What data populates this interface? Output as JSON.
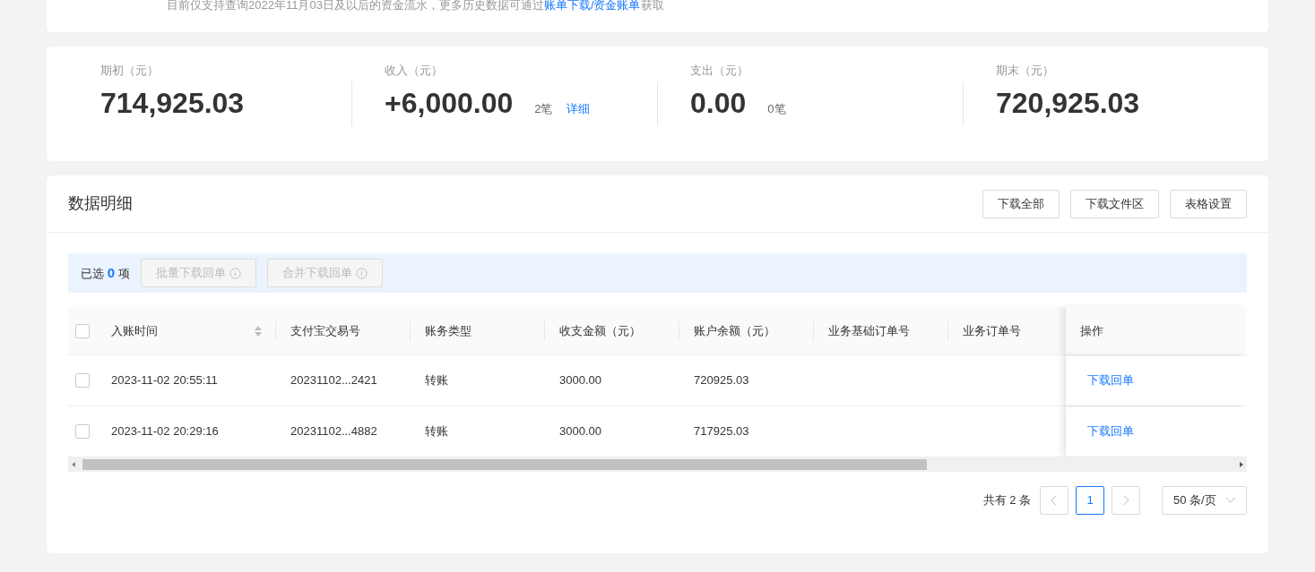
{
  "notice": {
    "text": "目前仅支持查询2022年11月03日及以后的资金流水，更多历史数据可通过",
    "link": "账单下载/资金账单",
    "suffix": "获取"
  },
  "summary": [
    {
      "label": "期初（元）",
      "value": "714,925.03"
    },
    {
      "label": "收入（元）",
      "value": "+6,000.00",
      "count": "2笔",
      "link": "详细"
    },
    {
      "label": "支出（元）",
      "value": "0.00",
      "count": "0笔"
    },
    {
      "label": "期末（元）",
      "value": "720,925.03"
    }
  ],
  "details": {
    "title": "数据明细",
    "buttons": [
      "下载全部",
      "下载文件区",
      "表格设置"
    ],
    "selection": {
      "prefix": "已选",
      "count": "0",
      "suffix": "项",
      "actions": [
        {
          "label": "批量下载回单",
          "disabled": true
        },
        {
          "label": "合并下载回单",
          "disabled": true
        }
      ]
    },
    "table": {
      "all_checked": false,
      "columns": [
        {
          "label": "入账时间",
          "sortable": true
        },
        {
          "label": "支付宝交易号",
          "sortable": false
        },
        {
          "label": "账务类型",
          "sortable": false
        },
        {
          "label": "收支金额（元）",
          "sortable": false
        },
        {
          "label": "账户余额（元）",
          "sortable": false
        },
        {
          "label": "业务基础订单号",
          "sortable": false
        },
        {
          "label": "业务订单号",
          "sortable": false
        },
        {
          "label": "操作",
          "sortable": false
        }
      ],
      "rows": [
        {
          "selected": false,
          "cells": [
            "2023-11-02 20:55:11",
            "20231102...2421",
            "转账",
            "3000.00",
            "720925.03",
            "",
            ""
          ],
          "action": "下载回单"
        },
        {
          "selected": false,
          "cells": [
            "2023-11-02 20:29:16",
            "20231102...4882",
            "转账",
            "3000.00",
            "717925.03",
            "",
            ""
          ],
          "action": "下载回单"
        }
      ]
    },
    "pagination": {
      "total": "共有 2 条",
      "pages": [
        {
          "label": "1",
          "selected": true
        }
      ],
      "page_size": "50 条/页"
    }
  }
}
